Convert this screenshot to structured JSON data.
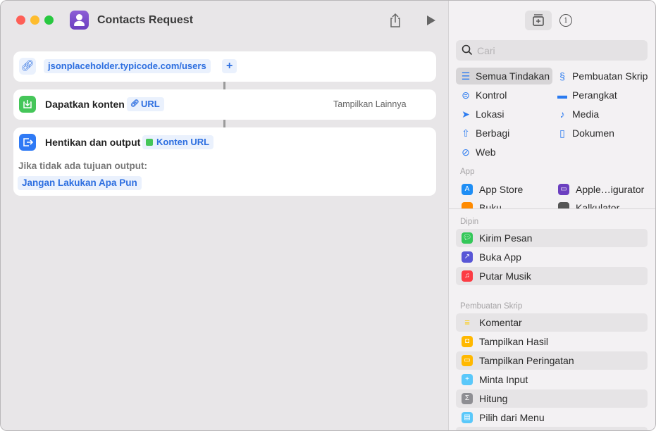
{
  "window": {
    "title": "Contacts Request"
  },
  "actions": {
    "url_value": "jsonplaceholder.typicode.com/users",
    "add_label": "+",
    "get_contents": {
      "label": "Dapatkan konten",
      "token": "URL",
      "show_more": "Tampilkan Lainnya"
    },
    "stop_output": {
      "label": "Hentikan dan output",
      "token": "Konten URL",
      "fallback_label": "Jika tidak ada tujuan output:",
      "fallback_value": "Jangan Lakukan Apa Pun"
    }
  },
  "sidebar": {
    "search_placeholder": "Cari",
    "categories": [
      {
        "label": "Semua Tindakan",
        "icon": "list-icon"
      },
      {
        "label": "Pembuatan Skrip",
        "icon": "scripting-icon"
      },
      {
        "label": "Kontrol",
        "icon": "toggle-icon"
      },
      {
        "label": "Perangkat",
        "icon": "display-icon"
      },
      {
        "label": "Lokasi",
        "icon": "location-icon"
      },
      {
        "label": "Media",
        "icon": "music-note-icon"
      },
      {
        "label": "Berbagi",
        "icon": "share-icon"
      },
      {
        "label": "Dokumen",
        "icon": "document-icon"
      },
      {
        "label": "Web",
        "icon": "compass-icon"
      }
    ],
    "app_header": "App",
    "apps": [
      {
        "label": "App Store"
      },
      {
        "label": "Apple…igurator"
      },
      {
        "label": "Buku"
      },
      {
        "label": "Kalkulator"
      }
    ],
    "pinned_header": "Dipin",
    "pinned": [
      {
        "label": "Kirim Pesan",
        "color": "#34c759"
      },
      {
        "label": "Buka App",
        "color": "#5856d6"
      },
      {
        "label": "Putar Musik",
        "color": "#fc3c44"
      }
    ],
    "scripting_header": "Pembuatan Skrip",
    "scripting": [
      {
        "label": "Komentar",
        "color": "#ffcc00"
      },
      {
        "label": "Tampilkan Hasil",
        "color": "#ffb800"
      },
      {
        "label": "Tampilkan Peringatan",
        "color": "#ffb800"
      },
      {
        "label": "Minta Input",
        "color": "#5ac8fa"
      },
      {
        "label": "Hitung",
        "color": "#8e8e93"
      },
      {
        "label": "Pilih dari Menu",
        "color": "#5ac8fa"
      }
    ]
  }
}
